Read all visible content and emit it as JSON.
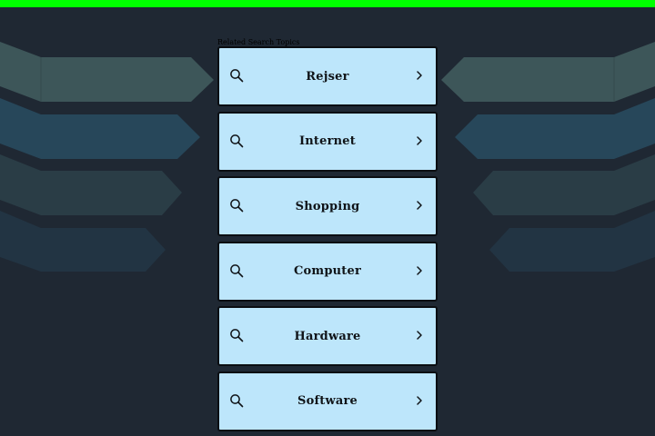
{
  "colors": {
    "top_bar": "#00ff00",
    "background": "#1f2833",
    "item_bg": "#bde6fb",
    "item_border": "#0b0e12"
  },
  "related_label": "Related Search Topics",
  "items": [
    {
      "label": "Rejser",
      "icon": "search-icon",
      "arrow": "chevron-right-icon"
    },
    {
      "label": "Internet",
      "icon": "search-icon",
      "arrow": "chevron-right-icon"
    },
    {
      "label": "Shopping",
      "icon": "search-icon",
      "arrow": "chevron-right-icon"
    },
    {
      "label": "Computer",
      "icon": "search-icon",
      "arrow": "chevron-right-icon"
    },
    {
      "label": "Hardware",
      "icon": "search-icon",
      "arrow": "chevron-right-icon"
    },
    {
      "label": "Software",
      "icon": "search-icon",
      "arrow": "chevron-right-icon"
    }
  ]
}
